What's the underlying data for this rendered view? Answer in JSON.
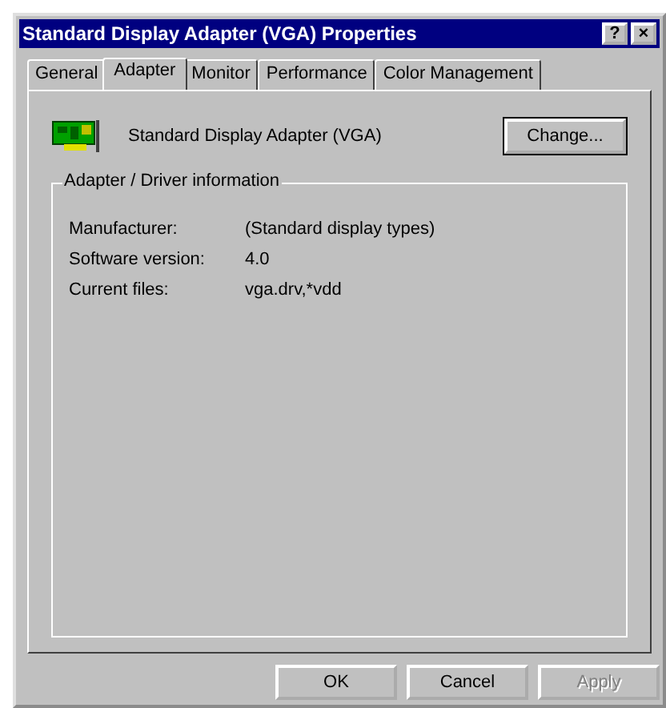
{
  "window": {
    "title": "Standard Display Adapter (VGA) Properties",
    "help_button": "?",
    "close_button": "×"
  },
  "tabs": [
    {
      "label": "General",
      "selected": false
    },
    {
      "label": "Adapter",
      "selected": true
    },
    {
      "label": "Monitor",
      "selected": false
    },
    {
      "label": "Performance",
      "selected": false
    },
    {
      "label": "Color Management",
      "selected": false
    }
  ],
  "adapter": {
    "name": "Standard Display Adapter (VGA)",
    "change_button": "Change..."
  },
  "group": {
    "title": "Adapter / Driver information",
    "rows": [
      {
        "label": "Manufacturer:",
        "value": "(Standard display types)"
      },
      {
        "label": "Software version:",
        "value": "4.0"
      },
      {
        "label": "Current files:",
        "value": "vga.drv,*vdd"
      }
    ]
  },
  "buttons": [
    {
      "label": "OK",
      "disabled": false
    },
    {
      "label": "Cancel",
      "disabled": false
    },
    {
      "label": "Apply",
      "disabled": true
    }
  ]
}
